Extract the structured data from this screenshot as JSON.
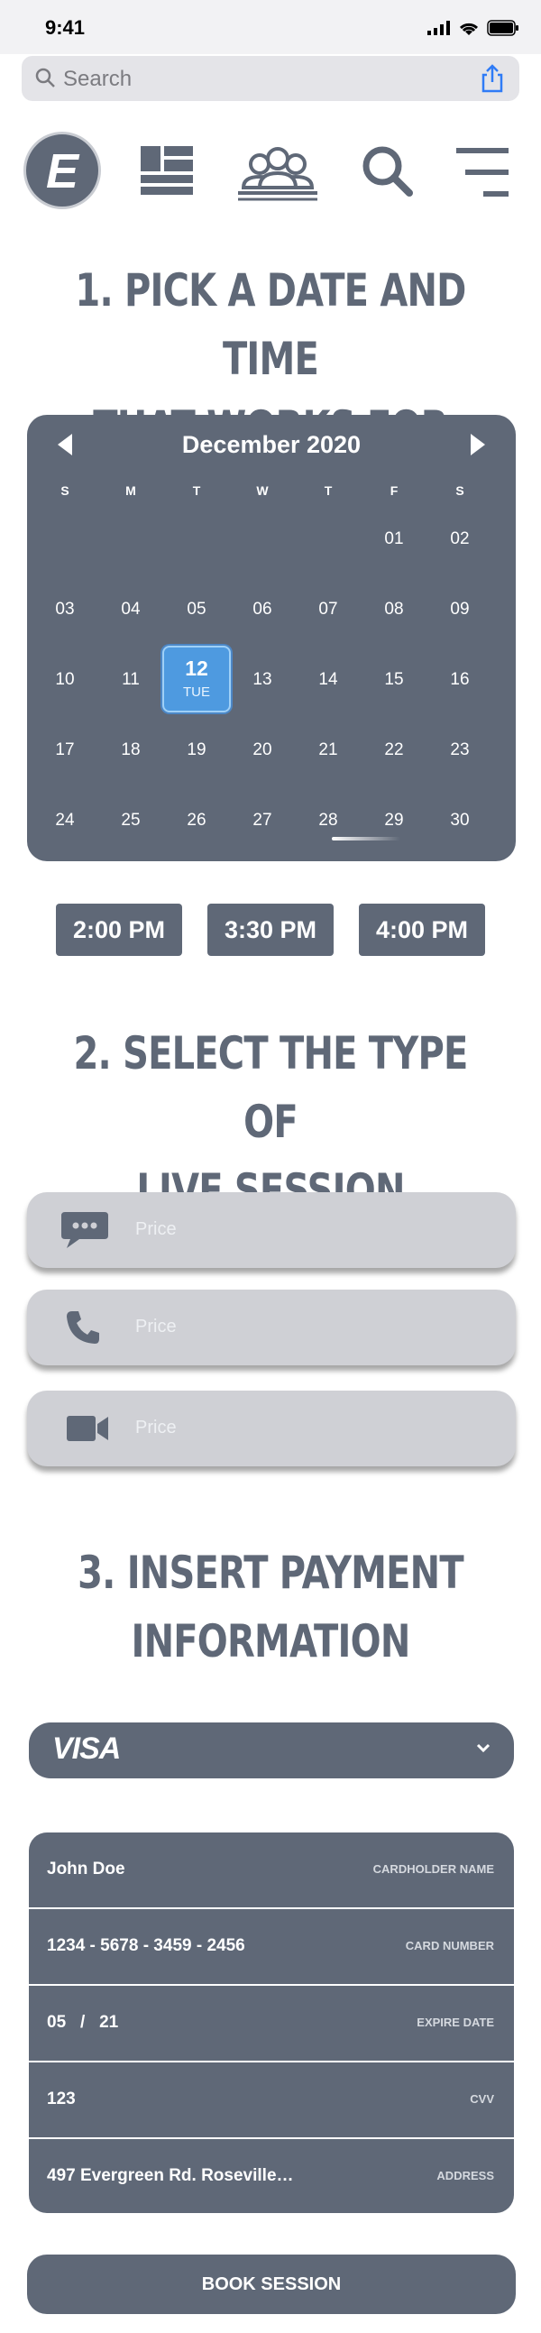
{
  "status": {
    "time": "9:41"
  },
  "browser": {
    "search_placeholder": "Search"
  },
  "logo": {
    "letter": "E"
  },
  "section1": {
    "line1": "1. PICK A DATE AND TIME",
    "line2": "THAT WORKS FOR YOU"
  },
  "calendar": {
    "month": "December 2020",
    "weekdays": [
      "S",
      "M",
      "T",
      "W",
      "T",
      "F",
      "S"
    ],
    "weeks": [
      [
        "",
        "",
        "",
        "",
        "",
        "01",
        "02"
      ],
      [
        "03",
        "04",
        "05",
        "06",
        "07",
        "08",
        "09"
      ],
      [
        "10",
        "11",
        "12",
        "13",
        "14",
        "15",
        "16"
      ],
      [
        "17",
        "18",
        "19",
        "20",
        "21",
        "22",
        "23"
      ],
      [
        "24",
        "25",
        "26",
        "27",
        "28",
        "29",
        "30"
      ]
    ],
    "selected_day": "12",
    "selected_dayname": "TUE"
  },
  "times": [
    "2:00 PM",
    "3:30 PM",
    "4:00 PM"
  ],
  "section2": {
    "line1": "2. SELECT THE TYPE OF",
    "line2": "LIVE SESSION"
  },
  "sessions": [
    {
      "icon": "chat-bubble-icon",
      "price": "Price"
    },
    {
      "icon": "phone-icon",
      "price": "Price"
    },
    {
      "icon": "video-camera-icon",
      "price": "Price"
    }
  ],
  "section3": {
    "line1": "3. INSERT PAYMENT",
    "line2": "INFORMATION"
  },
  "payment": {
    "card_brand": "VISA",
    "rows": [
      {
        "value": "John Doe",
        "label": "CARDHOLDER NAME"
      },
      {
        "value": "1234 - 5678 - 3459 - 2456",
        "label": "CARD NUMBER"
      },
      {
        "value": "05   /   21",
        "label": "EXPIRE DATE"
      },
      {
        "value": "123",
        "label": "CVV"
      },
      {
        "value": "497 Evergreen Rd. Roseville…",
        "label": "ADDRESS"
      }
    ]
  },
  "book_label": "BOOK SESSION",
  "colors": {
    "primary": "#5f6877",
    "selected": "#4e9ae0",
    "session_bg": "#cfd0d5"
  }
}
